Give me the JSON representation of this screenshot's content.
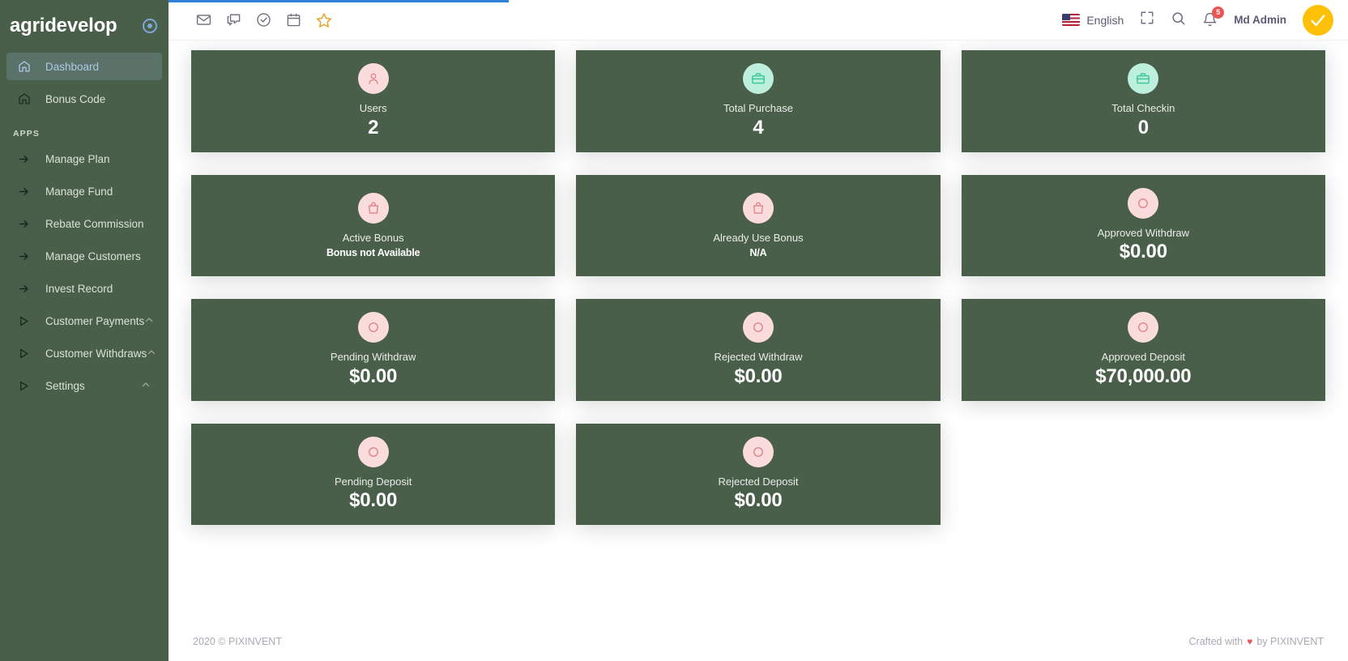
{
  "sidebar": {
    "brand": "agridevelop",
    "brand_pin_icon": "circle-target-icon",
    "section_label": "APPS",
    "items": [
      {
        "label": "Dashboard",
        "icon": "home-icon",
        "active": true,
        "type": "link"
      },
      {
        "label": "Bonus Code",
        "icon": "home-icon",
        "active": false,
        "type": "link"
      }
    ],
    "app_items": [
      {
        "label": "Manage Plan",
        "icon": "arrow-right-icon",
        "type": "link"
      },
      {
        "label": "Manage Fund",
        "icon": "arrow-right-icon",
        "type": "link"
      },
      {
        "label": "Rebate Commission",
        "icon": "arrow-right-icon",
        "type": "link"
      },
      {
        "label": "Manage Customers",
        "icon": "arrow-right-icon",
        "type": "link"
      },
      {
        "label": "Invest Record",
        "icon": "arrow-right-icon",
        "type": "link"
      },
      {
        "label": "Customer Payments",
        "icon": "triangle-right-icon",
        "type": "group",
        "caret": "chevron-up-icon"
      },
      {
        "label": "Customer Withdraws",
        "icon": "triangle-right-icon",
        "type": "group",
        "caret": "chevron-up-icon"
      },
      {
        "label": "Settings",
        "icon": "triangle-right-icon",
        "type": "group",
        "caret": "chevron-up-icon"
      }
    ]
  },
  "navbar": {
    "left_icons": [
      "mail-icon",
      "chat-icon",
      "check-circle-icon",
      "calendar-icon",
      "star-icon"
    ],
    "language": "English",
    "flag_icon": "us-flag-icon",
    "fullscreen_icon": "fullscreen-icon",
    "search_icon": "search-icon",
    "bell_icon": "bell-icon",
    "notification_count": "5",
    "user_name": "Md Admin",
    "avatar_icon": "check-avatar-icon"
  },
  "cards": [
    {
      "title": "Users",
      "value": "2",
      "icon": "user-icon",
      "icon_color": "pink",
      "value_size": "large"
    },
    {
      "title": "Total Purchase",
      "value": "4",
      "icon": "briefcase-icon",
      "icon_color": "mint",
      "value_size": "large"
    },
    {
      "title": "Total Checkin",
      "value": "0",
      "icon": "briefcase-icon",
      "icon_color": "mint",
      "value_size": "large"
    },
    {
      "title": "Active Bonus",
      "value": "Bonus not Available",
      "icon": "shopping-bag-icon",
      "icon_color": "pink",
      "value_size": "small"
    },
    {
      "title": "Already Use Bonus",
      "value": "N/A",
      "icon": "shopping-bag-icon",
      "icon_color": "pink",
      "value_size": "small"
    },
    {
      "title": "Approved Withdraw",
      "value": "$0.00",
      "icon": "circle-icon",
      "icon_color": "pink",
      "value_size": "large"
    },
    {
      "title": "Pending Withdraw",
      "value": "$0.00",
      "icon": "circle-icon",
      "icon_color": "pink",
      "value_size": "large"
    },
    {
      "title": "Rejected Withdraw",
      "value": "$0.00",
      "icon": "circle-icon",
      "icon_color": "pink",
      "value_size": "large"
    },
    {
      "title": "Approved Deposit",
      "value": "$70,000.00",
      "icon": "circle-icon",
      "icon_color": "pink",
      "value_size": "large"
    },
    {
      "title": "Pending Deposit",
      "value": "$0.00",
      "icon": "circle-icon",
      "icon_color": "pink",
      "value_size": "large"
    },
    {
      "title": "Rejected Deposit",
      "value": "$0.00",
      "icon": "circle-icon",
      "icon_color": "pink",
      "value_size": "large"
    }
  ],
  "footer": {
    "copyright": "2020 © PIXINVENT",
    "crafted_prefix": "Crafted with",
    "heart": "♥",
    "crafted_suffix": "by PIXINVENT"
  },
  "colors": {
    "green_card": "#4a5f4a",
    "pink_icon_bg": "#fbdcdd",
    "pink_icon_fg": "#e08b90",
    "mint_icon_bg": "#bdf0dc",
    "mint_icon_fg": "#3ec79a",
    "accent_blue": "#2f7ed8",
    "badge_red": "#ea5455",
    "avatar_yellow": "#ffc107"
  }
}
